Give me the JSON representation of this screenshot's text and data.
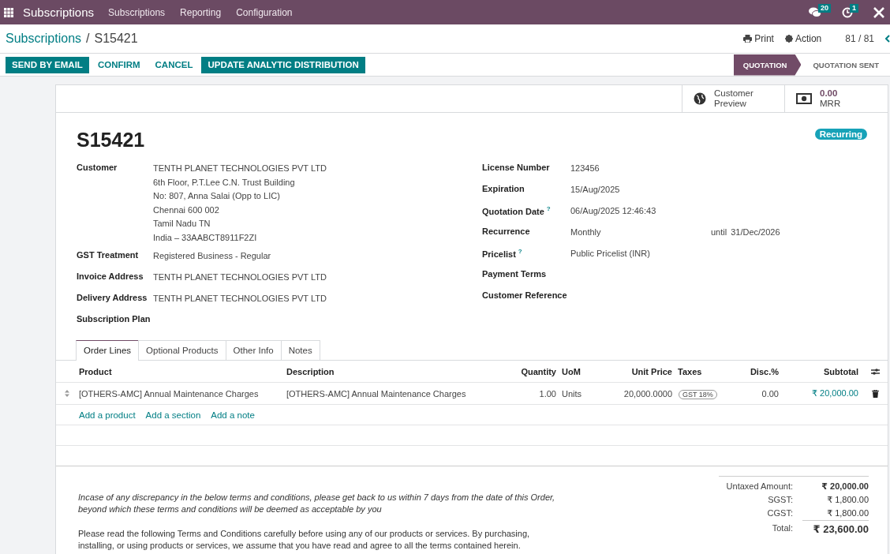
{
  "navbar": {
    "app": "Subscriptions",
    "menu": [
      "Subscriptions",
      "Reporting",
      "Configuration"
    ],
    "messages_count": "20",
    "activities_count": "1"
  },
  "breadcrumb": {
    "parent": "Subscriptions",
    "separator": "/",
    "current": "S15421"
  },
  "control": {
    "print": "Print",
    "action": "Action",
    "pager": "81 / 81"
  },
  "buttons": [
    {
      "label": "SEND BY EMAIL",
      "primary": true
    },
    {
      "label": "CONFIRM",
      "primary": false
    },
    {
      "label": "CANCEL",
      "primary": false
    },
    {
      "label": "UPDATE ANALYTIC DISTRIBUTION",
      "primary": true
    }
  ],
  "stages": [
    {
      "label": "QUOTATION",
      "selected": true
    },
    {
      "label": "QUOTATION SENT",
      "selected": false
    }
  ],
  "smart_buttons": [
    {
      "kind": "preview",
      "label": "Customer Preview"
    },
    {
      "kind": "mrr",
      "value": "0.00",
      "label": "MRR"
    }
  ],
  "record": {
    "name": "S15421",
    "badge": "Recurring"
  },
  "left_fields": [
    {
      "label": "Customer",
      "lines": [
        "TENTH PLANET TECHNOLOGIES PVT LTD",
        "6th Floor, P.T.Lee C.N. Trust Building",
        "No: 807, Anna Salai (Opp to LIC)",
        "Chennai 600 002",
        "Tamil Nadu TN",
        "India – 33AABCT8911F2ZI"
      ]
    },
    {
      "label": "GST Treatment",
      "lines": [
        "Registered Business - Regular"
      ]
    },
    {
      "label": "Invoice Address",
      "lines": [
        "TENTH PLANET TECHNOLOGIES PVT LTD"
      ]
    },
    {
      "label": "Delivery Address",
      "lines": [
        "TENTH PLANET TECHNOLOGIES PVT LTD"
      ]
    },
    {
      "label": "Subscription Plan"
    }
  ],
  "right_fields": [
    {
      "label": "License Number",
      "value": "123456"
    },
    {
      "label": "Expiration",
      "value": "15/Aug/2025"
    },
    {
      "label": "Quotation Date",
      "help": "?",
      "value": "06/Aug/2025 12:46:43"
    },
    {
      "label": "Recurrence",
      "value": "Monthly",
      "until": "until",
      "until_date": "31/Dec/2026"
    },
    {
      "label": "Pricelist",
      "help": "?",
      "value": "Public Pricelist (INR)"
    },
    {
      "label": "Payment Terms"
    },
    {
      "label": "Customer Reference"
    }
  ],
  "tabs": [
    {
      "label": "Order Lines",
      "selected": true
    },
    {
      "label": "Optional Products",
      "selected": false
    },
    {
      "label": "Other Info",
      "selected": false
    },
    {
      "label": "Notes",
      "selected": false
    }
  ],
  "table": {
    "columns": [
      "Product",
      "Description",
      "Quantity",
      "UoM",
      "Unit Price",
      "Taxes",
      "Disc.%",
      "Subtotal"
    ],
    "rows": [
      {
        "product": "[OTHERS-AMC] Annual Maintenance Charges",
        "description": "[OTHERS-AMC] Annual Maintenance Charges",
        "quantity": "1.00",
        "uom": "Units",
        "unit_price": "20,000.0000",
        "taxes": [
          "GST 18%"
        ],
        "discount": "0.00",
        "subtotal": "₹ 20,000.00"
      }
    ],
    "add_links": [
      "Add a product",
      "Add a section",
      "Add a note"
    ]
  },
  "notes": [
    "Incase of any discrepancy in the below terms and conditions, please get back to us within 7 days from the date of this Order, beyond which these terms and conditions will be deemed as acceptable by you",
    "Please read the following Terms and Conditions carefully before using any of our products or services. By purchasing, installing, or using products or services, we assume that you have read and agree to all the terms contained herein."
  ],
  "totals": [
    {
      "label": "Untaxed Amount:",
      "value": "₹ 20,000.00",
      "kind": "untaxed"
    },
    {
      "label": "SGST:",
      "value": "₹ 1,800.00",
      "kind": "tax"
    },
    {
      "label": "CGST:",
      "value": "₹ 1,800.00",
      "kind": "tax"
    },
    {
      "label": "Total:",
      "value": "₹ 23,600.00",
      "kind": "total"
    }
  ]
}
